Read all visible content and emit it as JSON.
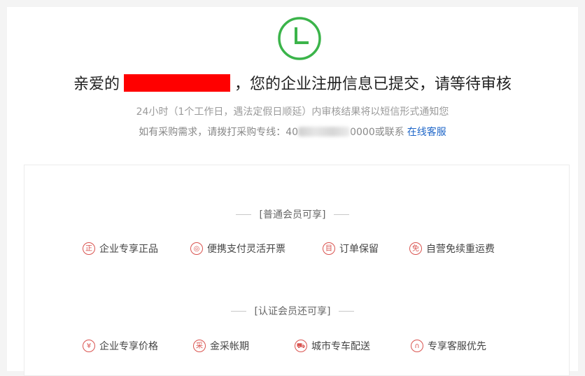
{
  "status": {
    "icon": "clock-icon",
    "accent_color": "#3bb44a",
    "headline_prefix": "亲爱的",
    "headline_suffix": "，您的企业注册信息已提交，请等待审核",
    "redaction_color": "#ff0000"
  },
  "info": {
    "line1": "24小时（1个工作日，遇法定假日顺延）内审核结果将以短信形式通知您",
    "line2_prefix": "如有采购需求，请拨打采购专线：40",
    "line2_suffix": "0000或联系",
    "service_link": "在线客服",
    "link_color": "#1e66c8"
  },
  "benefits": {
    "accent_color": "#d9534f",
    "regular": {
      "title": "[普通会员可享]",
      "items": [
        {
          "icon_glyph": "正",
          "icon": "genuine-icon",
          "label": "企业专享正品"
        },
        {
          "icon_glyph": "◎",
          "icon": "invoice-icon",
          "label": "便携支付灵活开票"
        },
        {
          "icon_glyph": "目",
          "icon": "order-icon",
          "label": "订单保留"
        },
        {
          "icon_glyph": "免",
          "icon": "free-shipping-icon",
          "label": "自营免续重运费"
        }
      ]
    },
    "certified": {
      "title": "[认证会员还可享]",
      "items": [
        {
          "icon_glyph": "¥",
          "icon": "price-icon",
          "label": "企业专享价格"
        },
        {
          "icon_glyph": "采",
          "icon": "procurement-icon",
          "label": "金采帐期"
        },
        {
          "icon_glyph": "⛟",
          "icon": "delivery-icon",
          "label": "城市专车配送"
        },
        {
          "icon_glyph": "∩",
          "icon": "support-icon",
          "label": "专享客服优先"
        }
      ]
    }
  }
}
